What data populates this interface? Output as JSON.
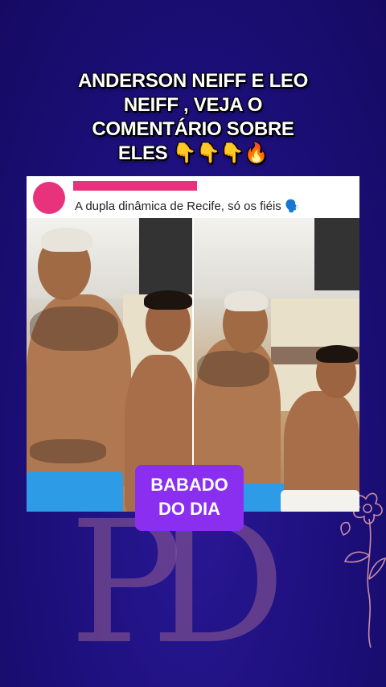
{
  "headline": {
    "line1": "ANDERSON NEIFF E LEO",
    "line2": "NEIFF , VEJA O",
    "line3": "COMENTÁRIO SOBRE",
    "line4": "ELES 👇👇👇🔥"
  },
  "post": {
    "comment_text": "A dupla dinâmica de Recife, só os fiéis 🗣️"
  },
  "badge": {
    "line1": "BABADO",
    "line2": "DO DIA"
  },
  "monogram": "PD",
  "colors": {
    "background": "#1c0f7a",
    "accent_pink": "#e8337c",
    "badge_purple": "#8a2ff0"
  }
}
